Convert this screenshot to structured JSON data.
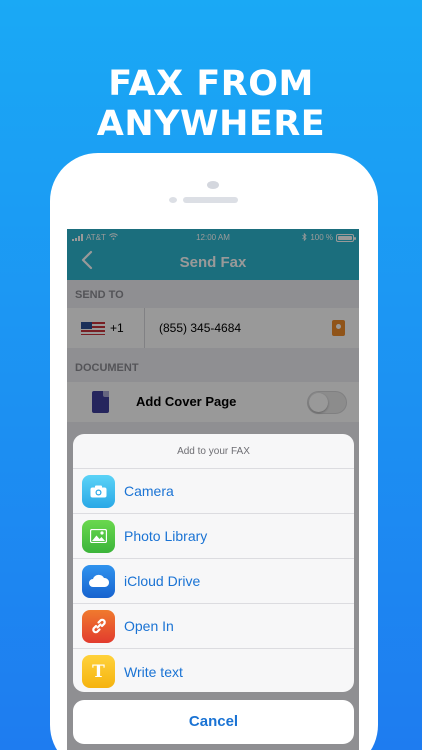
{
  "headline": "FAX FROM ANYWHERE",
  "status_bar": {
    "carrier": "AT&T",
    "time": "12:00 AM",
    "battery": "100 %"
  },
  "nav": {
    "title": "Send Fax"
  },
  "send_to": {
    "label": "SEND TO",
    "country_code": "+1",
    "phone_number": "(855) 345-4684"
  },
  "document": {
    "label": "DOCUMENT",
    "cover_page_label": "Add Cover Page"
  },
  "action_sheet": {
    "title": "Add to your FAX",
    "items": [
      {
        "label": "Camera",
        "icon": "camera-icon"
      },
      {
        "label": "Photo Library",
        "icon": "photo-library-icon"
      },
      {
        "label": "iCloud Drive",
        "icon": "icloud-icon"
      },
      {
        "label": "Open In",
        "icon": "link-icon"
      },
      {
        "label": "Write text",
        "icon": "text-icon",
        "glyph": "T"
      }
    ],
    "cancel_label": "Cancel"
  },
  "colors": {
    "nav_bar": "#2db8d0",
    "action_text": "#1a73d4",
    "background_top": "#1aa9f5"
  }
}
